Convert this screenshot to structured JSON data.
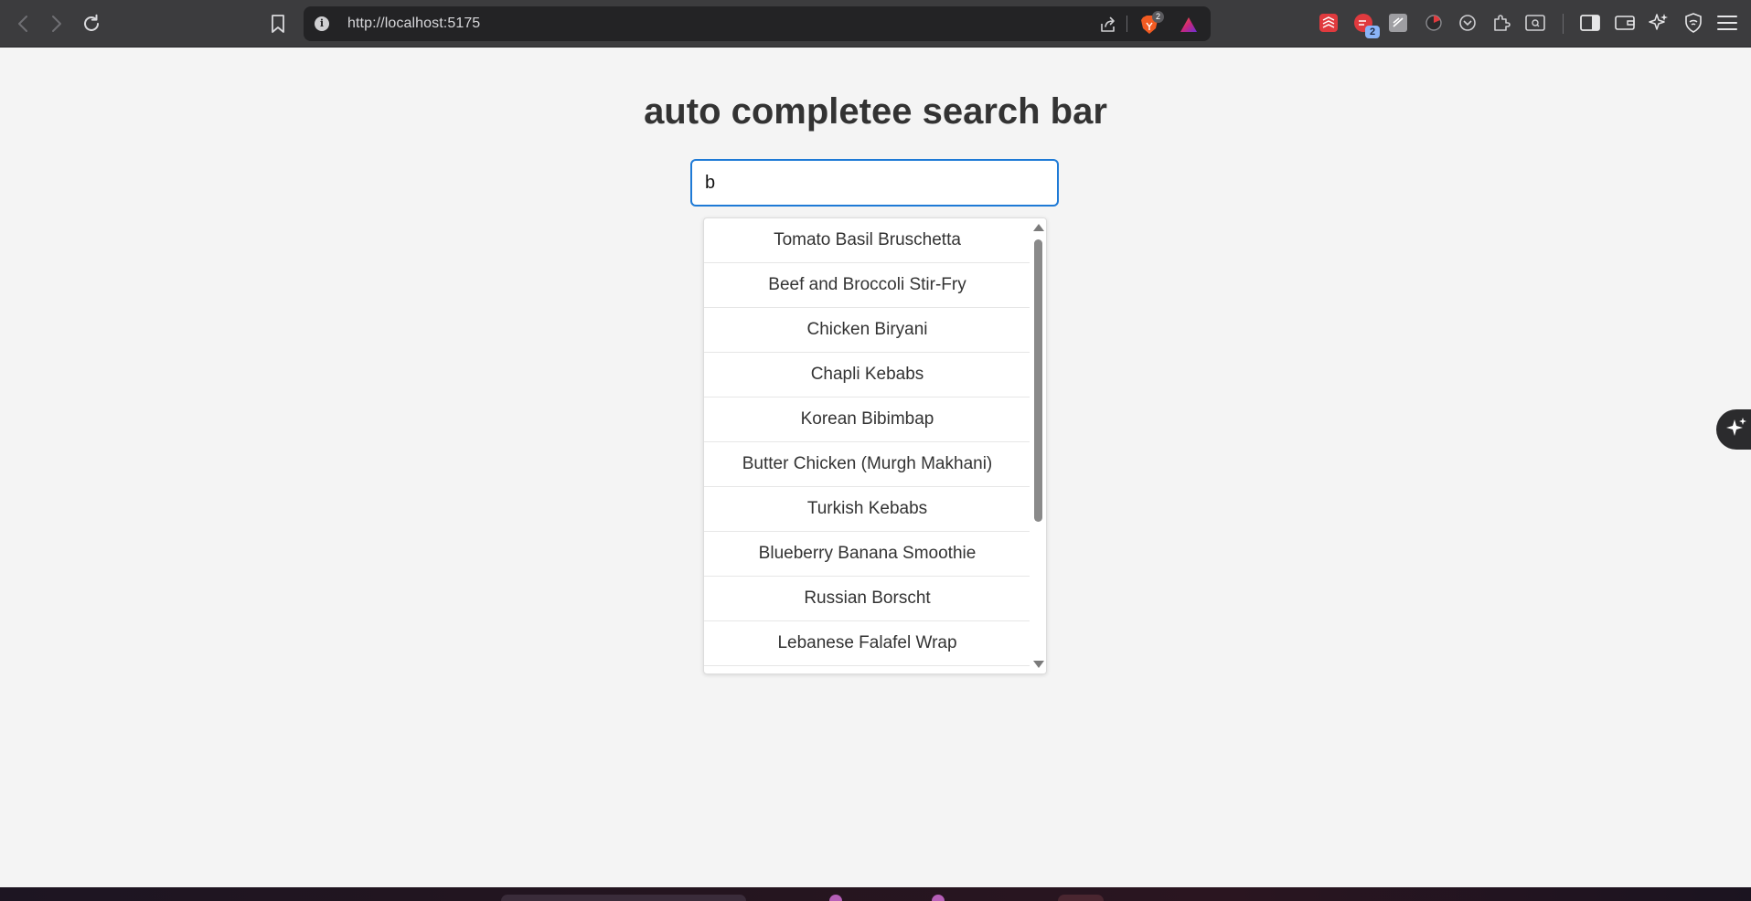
{
  "browser": {
    "url": "http://localhost:5175",
    "shield_badge_count": "2",
    "extension_badge_count": "2",
    "colors": {
      "toolbar_bg": "#3c3c3e",
      "urlbar_bg": "#232325",
      "brave_orange": "#f25b22",
      "extension_red": "#e03a3e"
    }
  },
  "page": {
    "title": "auto completee search bar",
    "search": {
      "value": "b",
      "placeholder": ""
    },
    "suggestions": [
      "Tomato Basil Bruschetta",
      "Beef and Broccoli Stir-Fry",
      "Chicken Biryani",
      "Chapli Kebabs",
      "Korean Bibimbap",
      "Butter Chicken (Murgh Makhani)",
      "Turkish Kebabs",
      "Blueberry Banana Smoothie",
      "Russian Borscht",
      "Lebanese Falafel Wrap"
    ],
    "colors": {
      "background": "#f4f4f4",
      "input_border": "#1e7ad6",
      "text": "#333333"
    }
  },
  "icons": {
    "back": "back-arrow-icon",
    "forward": "forward-arrow-icon",
    "reload": "reload-icon",
    "bookmark": "bookmark-icon",
    "site_info": "info-icon",
    "share": "share-icon",
    "brave_shields": "brave-lion-icon",
    "brave_rewards": "rewards-triangle-icon",
    "leo": "sparkle-icon"
  }
}
